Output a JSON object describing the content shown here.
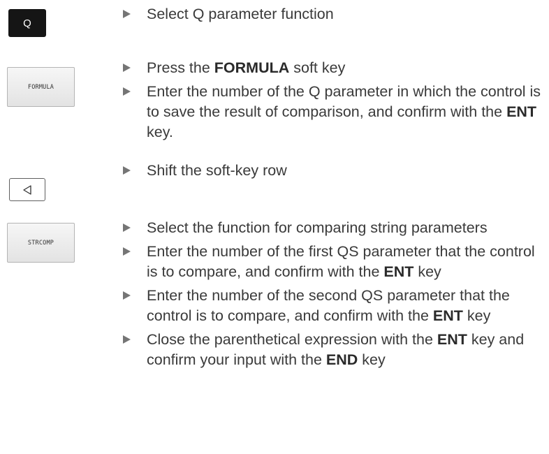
{
  "keys": {
    "q": "Q",
    "formula": "FORMULA",
    "strcomp": "STRCOMP"
  },
  "steps": [
    {
      "text": "Select Q parameter function"
    },
    {
      "pre": "Press the ",
      "bold": "FORMULA",
      "post": " soft key"
    },
    {
      "text": "Enter the number of the Q parameter in which the control is to save the result of comparison, and confirm with the ",
      "bold": "ENT",
      "post": " key."
    },
    {
      "text": "Shift the soft-key row"
    },
    {
      "text": "Select the function for comparing string parameters"
    },
    {
      "text": "Enter the number of the first QS parameter that the control is to compare, and confirm with the ",
      "bold": "ENT",
      "post": " key"
    },
    {
      "text": "Enter the number of the second QS parameter that the control is to compare, and confirm with the ",
      "bold": "ENT",
      "post": " key"
    },
    {
      "text": "Close the parenthetical expression with the ",
      "bold": "ENT",
      "mid": " key and confirm your input with the ",
      "bold2": "END",
      "post": " key"
    }
  ]
}
